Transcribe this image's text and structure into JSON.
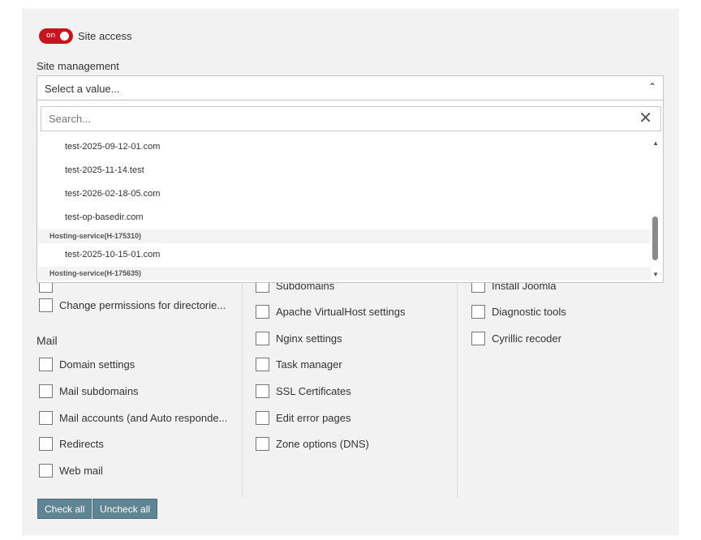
{
  "site_access": {
    "toggle_state": "on",
    "label": "Site access"
  },
  "site_management": {
    "label": "Site management",
    "placeholder": "Select a value...",
    "search_placeholder": "Search...",
    "options": [
      {
        "type": "option",
        "label": "test-2025-09-12-01.com"
      },
      {
        "type": "option",
        "label": "test-2025-11-14.test"
      },
      {
        "type": "option",
        "label": "test-2026-02-18-05.com"
      },
      {
        "type": "option",
        "label": "test-op-basedir.com"
      },
      {
        "type": "group",
        "label": "Hosting-service(H-175310)"
      },
      {
        "type": "option",
        "label": "test-2025-10-15-01.com"
      },
      {
        "type": "group",
        "label": "Hosting-service(H-175635)"
      }
    ]
  },
  "col1": {
    "items_top": [
      {
        "label": "Change permissions for directorie..."
      }
    ],
    "mail_title": "Mail",
    "mail_items": [
      {
        "label": "Domain settings"
      },
      {
        "label": "Mail subdomains"
      },
      {
        "label": "Mail accounts (and Auto responde..."
      },
      {
        "label": "Redirects"
      },
      {
        "label": "Web mail"
      }
    ]
  },
  "col2": {
    "items": [
      {
        "label": "Subdomains"
      },
      {
        "label": "Apache VirtualHost settings"
      },
      {
        "label": "Nginx settings"
      },
      {
        "label": "Task manager"
      },
      {
        "label": "SSL Certificates"
      },
      {
        "label": "Edit error pages"
      },
      {
        "label": "Zone options (DNS)"
      }
    ]
  },
  "col3": {
    "items": [
      {
        "label": "Install Joomla"
      },
      {
        "label": "Diagnostic tools"
      },
      {
        "label": "Cyrillic recoder"
      }
    ]
  },
  "buttons": {
    "check_all": "Check all",
    "uncheck_all": "Uncheck all"
  },
  "colors": {
    "toggle": "#c8141e",
    "button": "#5f8493",
    "panel": "#f2f2f2"
  }
}
